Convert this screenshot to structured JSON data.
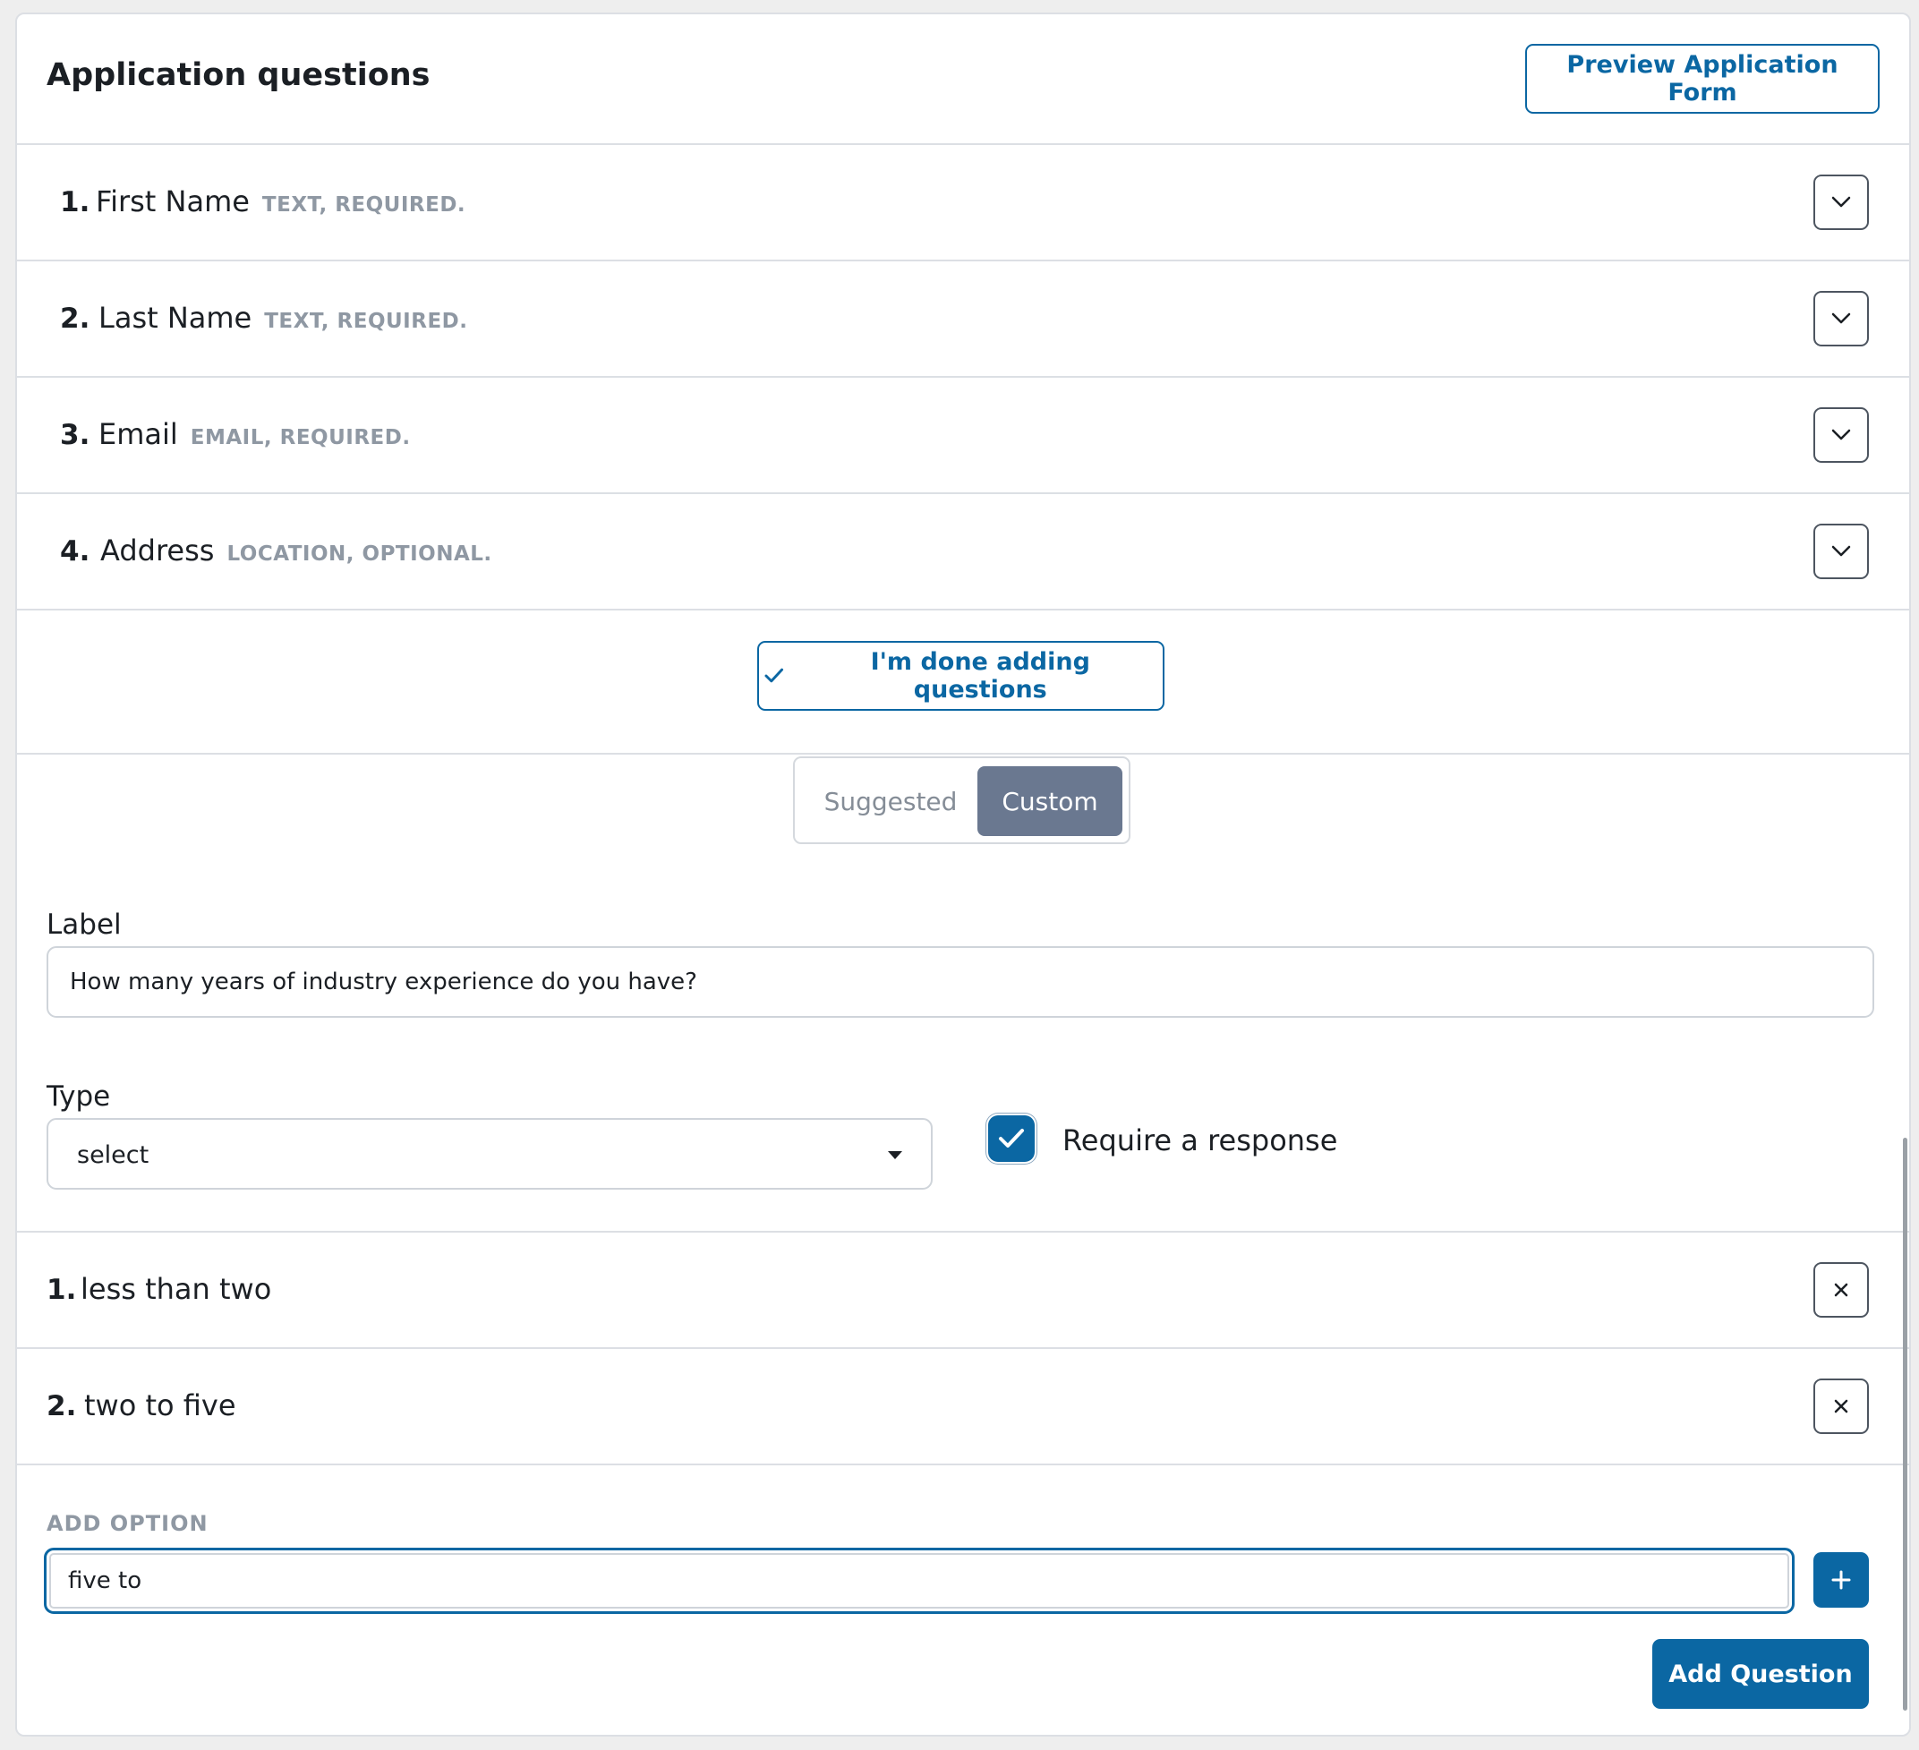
{
  "header": {
    "title": "Application questions",
    "preview_label": "Preview Application Form"
  },
  "questions": [
    {
      "num": "1.",
      "name": "First Name",
      "meta": "TEXT, REQUIRED.",
      "icon": "chevron-down-icon"
    },
    {
      "num": "2.",
      "name": "Last Name",
      "meta": "TEXT, REQUIRED.",
      "icon": "chevron-down-icon"
    },
    {
      "num": "3.",
      "name": "Email",
      "meta": "EMAIL, REQUIRED.",
      "icon": "chevron-down-icon"
    },
    {
      "num": "4.",
      "name": "Address",
      "meta": "LOCATION, OPTIONAL.",
      "icon": "chevron-down-icon"
    }
  ],
  "done_button": {
    "label": "I'm done adding questions",
    "icon": "check-icon"
  },
  "mode_toggle": {
    "options": [
      "Suggested",
      "Custom"
    ],
    "selected": "Custom"
  },
  "form": {
    "label_title": "Label",
    "label_value": "How many years of industry experience do you have?",
    "type_title": "Type",
    "type_value": "select",
    "require_checked": true,
    "require_label": "Require a response"
  },
  "options": [
    {
      "num": "1.",
      "text": "less than two",
      "icon": "close-icon"
    },
    {
      "num": "2.",
      "text": "two to five",
      "icon": "close-icon"
    }
  ],
  "add_option": {
    "label": "ADD OPTION",
    "value": "five to",
    "icon": "plus-icon"
  },
  "add_question_label": "Add Question",
  "colors": {
    "accent": "#0b67a3",
    "toggle_selected": "#6a7890",
    "muted_text": "#8f98a3",
    "border": "#dcdfe4"
  }
}
